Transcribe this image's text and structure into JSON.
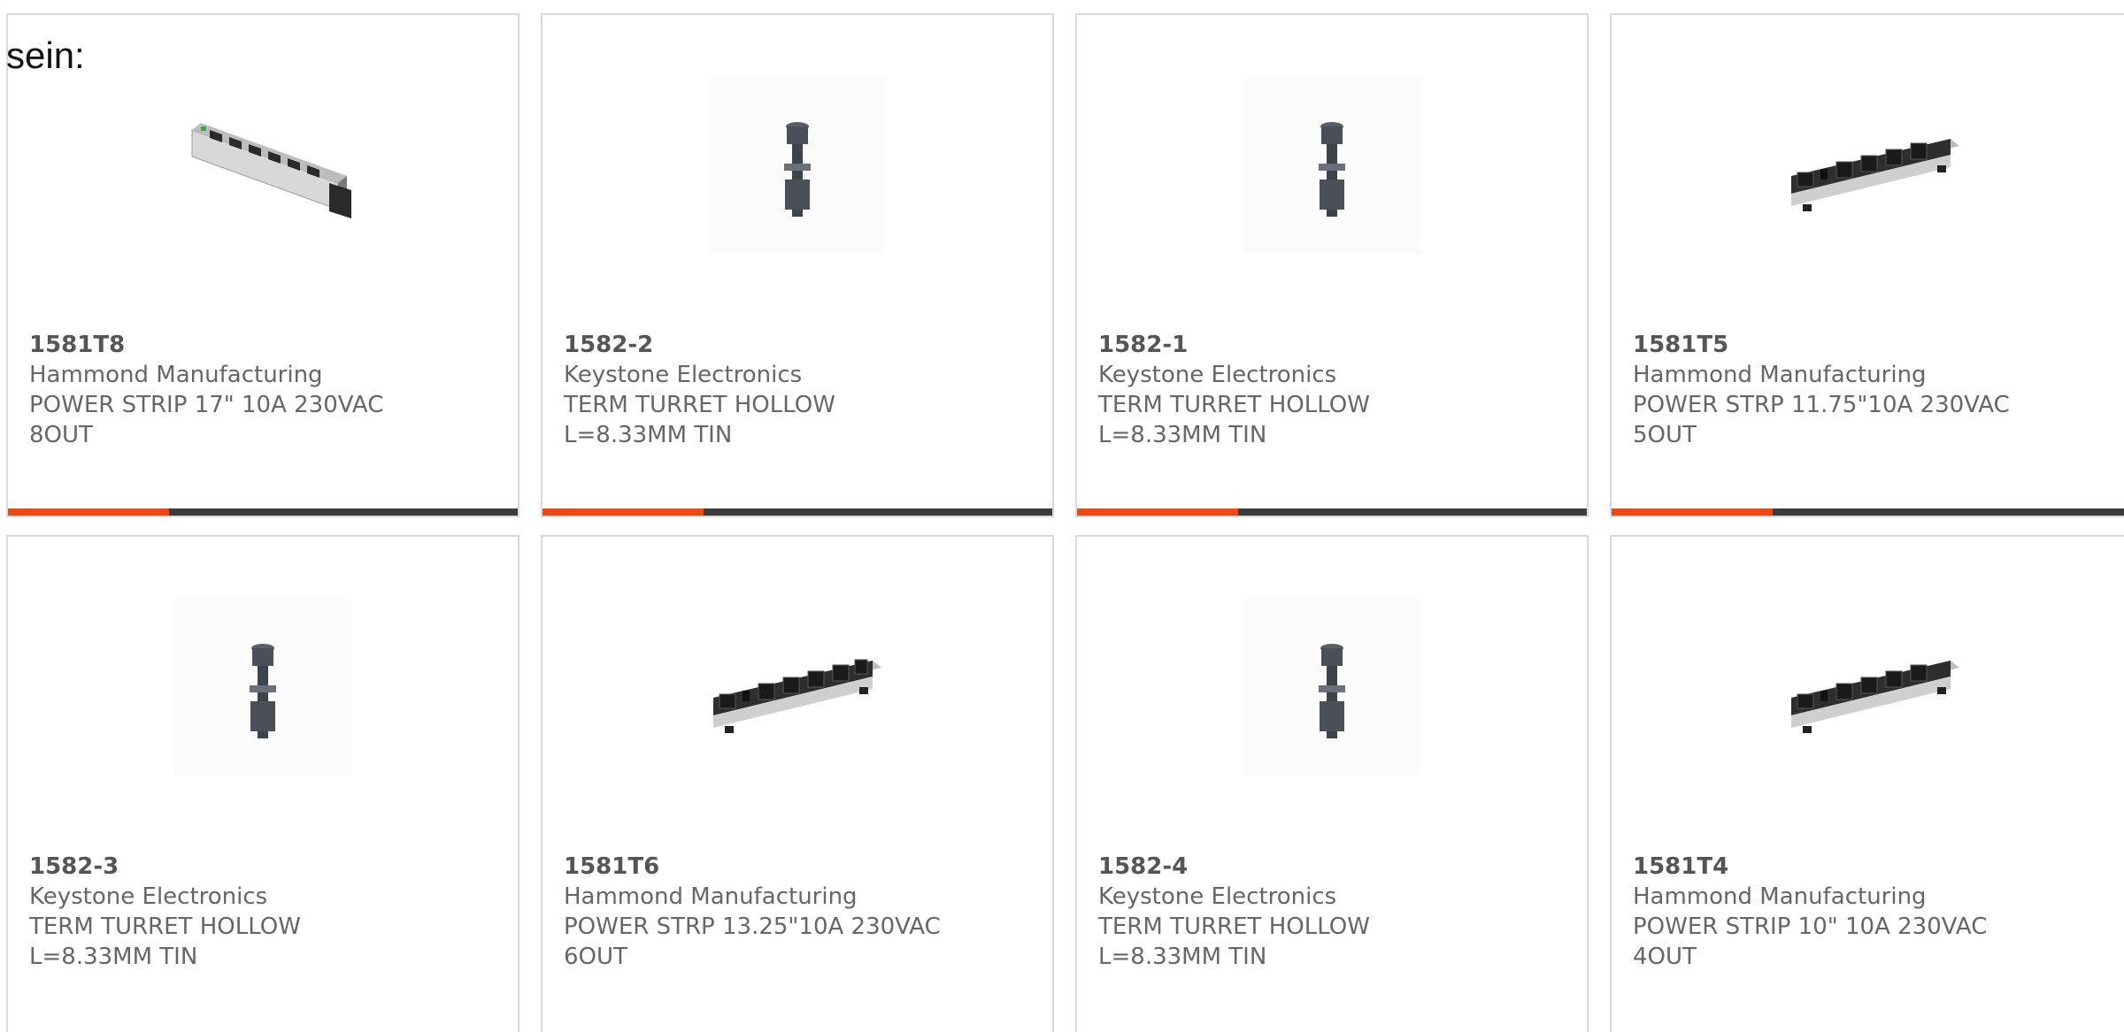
{
  "heading_fragment": "sein:",
  "products": [
    {
      "part": "1581T8",
      "manufacturer": "Hammond Manufacturing",
      "desc_line1": "POWER STRIP 17\" 10A 230VAC",
      "desc_line2": "8OUT",
      "image_icon": "power-strip-angled-icon",
      "accent_color": "#e84a12"
    },
    {
      "part": "1582-2",
      "manufacturer": "Keystone Electronics",
      "desc_line1": "TERM TURRET HOLLOW",
      "desc_line2": "L=8.33MM TIN",
      "image_icon": "turret-terminal-icon",
      "accent_color": "#e84a12"
    },
    {
      "part": "1582-1",
      "manufacturer": "Keystone Electronics",
      "desc_line1": "TERM TURRET HOLLOW",
      "desc_line2": "L=8.33MM TIN",
      "image_icon": "turret-terminal-icon",
      "accent_color": "#e84a12"
    },
    {
      "part": "1581T5",
      "manufacturer": "Hammond Manufacturing",
      "desc_line1": "POWER STRP 11.75\"10A 230VAC",
      "desc_line2": "5OUT",
      "image_icon": "power-strip-icon",
      "accent_color": "#e84a12"
    },
    {
      "part": "1582-3",
      "manufacturer": "Keystone Electronics",
      "desc_line1": "TERM TURRET HOLLOW",
      "desc_line2": "L=8.33MM TIN",
      "image_icon": "turret-terminal-icon"
    },
    {
      "part": "1581T6",
      "manufacturer": "Hammond Manufacturing",
      "desc_line1": "POWER STRP 13.25\"10A 230VAC",
      "desc_line2": "6OUT",
      "image_icon": "power-strip-icon"
    },
    {
      "part": "1582-4",
      "manufacturer": "Keystone Electronics",
      "desc_line1": "TERM TURRET HOLLOW",
      "desc_line2": "L=8.33MM TIN",
      "image_icon": "turret-terminal-icon"
    },
    {
      "part": "1581T4",
      "manufacturer": "Hammond Manufacturing",
      "desc_line1": "POWER STRIP 10\" 10A 230VAC",
      "desc_line2": "4OUT",
      "image_icon": "power-strip-icon"
    }
  ],
  "colors": {
    "accent": "#e84a12",
    "bar": "#3c3c3c",
    "text": "#666666",
    "border": "#d9d9d9"
  }
}
